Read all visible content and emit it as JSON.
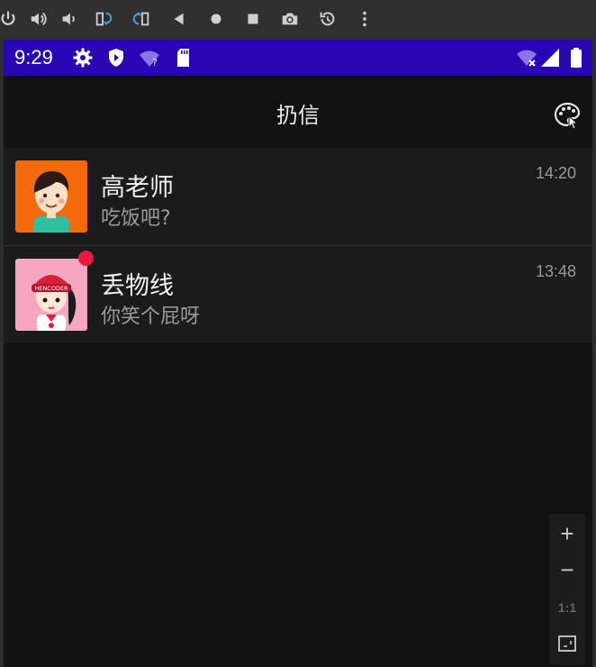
{
  "emulator_toolbar": {
    "items": [
      "power-icon",
      "volume-up-icon",
      "volume-down-icon",
      "rotate-left-icon",
      "rotate-right-icon",
      "back-icon",
      "home-icon",
      "overview-icon",
      "camera-icon",
      "replay-icon",
      "more-icon"
    ]
  },
  "status_bar": {
    "time": "9:29",
    "icons_left": [
      "settings-icon",
      "shield-icon",
      "wifi-question-icon",
      "sd-card-icon"
    ],
    "icons_right": [
      "wifi-off-icon",
      "signal-icon",
      "battery-icon"
    ],
    "color": "#2a07b5"
  },
  "app_bar": {
    "title": "扔信",
    "action_icon": "palette-icon"
  },
  "chats": [
    {
      "name": "高老师",
      "message": "吃饭吧?",
      "time": "14:20",
      "unread": false
    },
    {
      "name": "丢物线",
      "message": "你笑个屁呀",
      "time": "13:48",
      "unread": true
    }
  ],
  "zoom_controls": {
    "zoom_in": "+",
    "zoom_out": "−",
    "actual_size": "1:1",
    "fit_icon": "fit-screen-icon"
  }
}
